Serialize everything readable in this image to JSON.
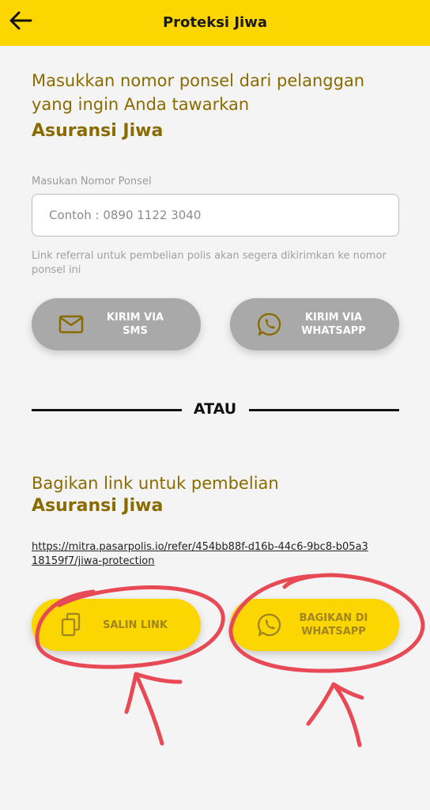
{
  "header": {
    "title": "Proteksi Jiwa"
  },
  "send_section": {
    "heading": "Masukkan nomor ponsel dari pelanggan yang ingin Anda tawarkan",
    "product": "Asuransi Jiwa",
    "field_label": "Masukan Nomor Ponsel",
    "placeholder": "Contoh : 0890 1122 3040",
    "value": "",
    "helper": "Link referral untuk pembelian polis akan segera dikirimkan ke nomor ponsel ini",
    "sms_label": "KIRIM VIA SMS",
    "whatsapp_label": "KIRIM VIA WHATSAPP"
  },
  "divider": {
    "text": "ATAU"
  },
  "share_section": {
    "heading": "Bagikan link untuk pembelian",
    "product": "Asuransi Jiwa",
    "link": "https://mitra.pasarpolis.io/refer/454bb88f-d16b-44c6-9bc8-b05a318159f7/jiwa-protection",
    "copy_label": "SALIN LINK",
    "share_whatsapp_label": "BAGIKAN DI WHATSAPP"
  },
  "colors": {
    "brand_yellow": "#fcd600",
    "heading_gold": "#8a6b00",
    "disabled_grey": "#a9a9a9",
    "annotation_red": "#e84a55"
  },
  "icons": [
    "back-arrow-icon",
    "mail-icon",
    "whatsapp-icon",
    "copy-icon"
  ]
}
